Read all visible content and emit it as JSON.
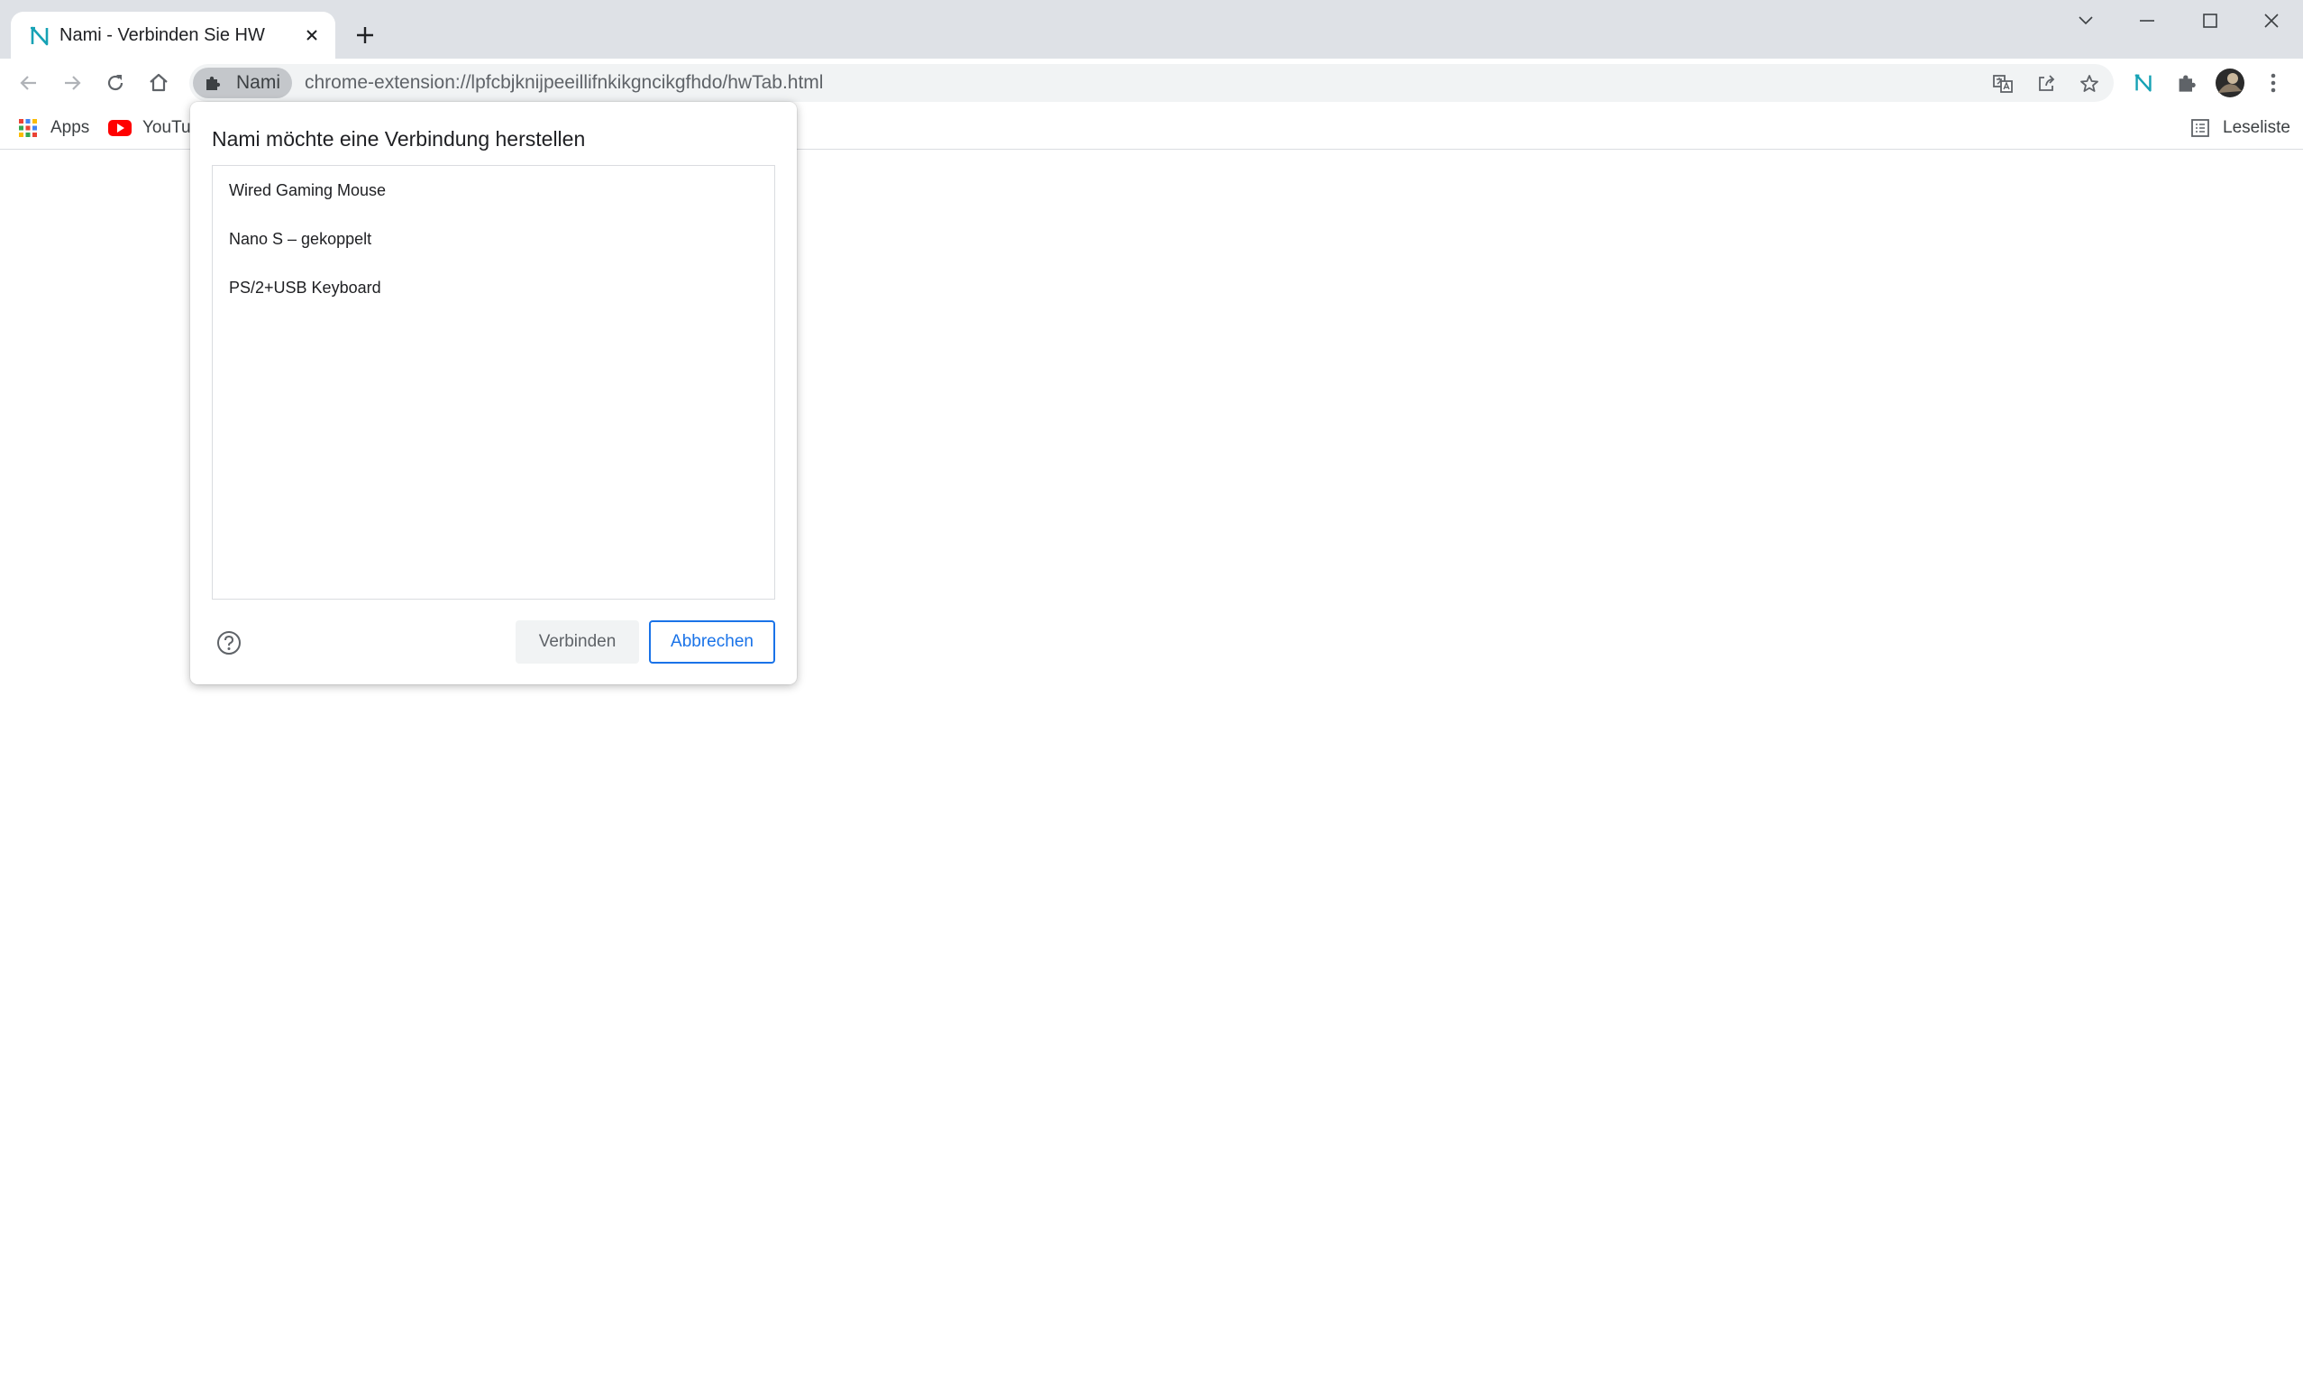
{
  "colors": {
    "accent": "#1a73e8",
    "tabstrip_bg": "#dee1e6",
    "omnibox_bg": "#f1f3f4",
    "nami_brand": "#16a2b5"
  },
  "tab": {
    "title": "Nami - Verbinden Sie HW",
    "favicon": "nami-logo-icon",
    "close_icon": "close-icon",
    "new_tab_icon": "plus-icon"
  },
  "window_controls": [
    "chevron-down-icon",
    "minimize-icon",
    "maximize-icon",
    "close-icon"
  ],
  "toolbar": {
    "extension_chip_label": "Nami",
    "url": "chrome-extension://lpfcbjknijpeeillifnkikgncikgfhdo/hwTab.html"
  },
  "bookmarks": {
    "items": [
      {
        "label": "Apps",
        "icon": "apps-grid-icon"
      },
      {
        "label": "YouTube",
        "icon": "youtube-icon"
      }
    ],
    "reading_list_label": "Leseliste"
  },
  "dialog": {
    "title": "Nami möchte eine Verbindung herstellen",
    "devices": [
      "Wired Gaming Mouse",
      "Nano S – gekoppelt",
      "PS/2+USB Keyboard"
    ],
    "connect_label": "Verbinden",
    "cancel_label": "Abbrechen",
    "help_icon": "help-icon"
  }
}
